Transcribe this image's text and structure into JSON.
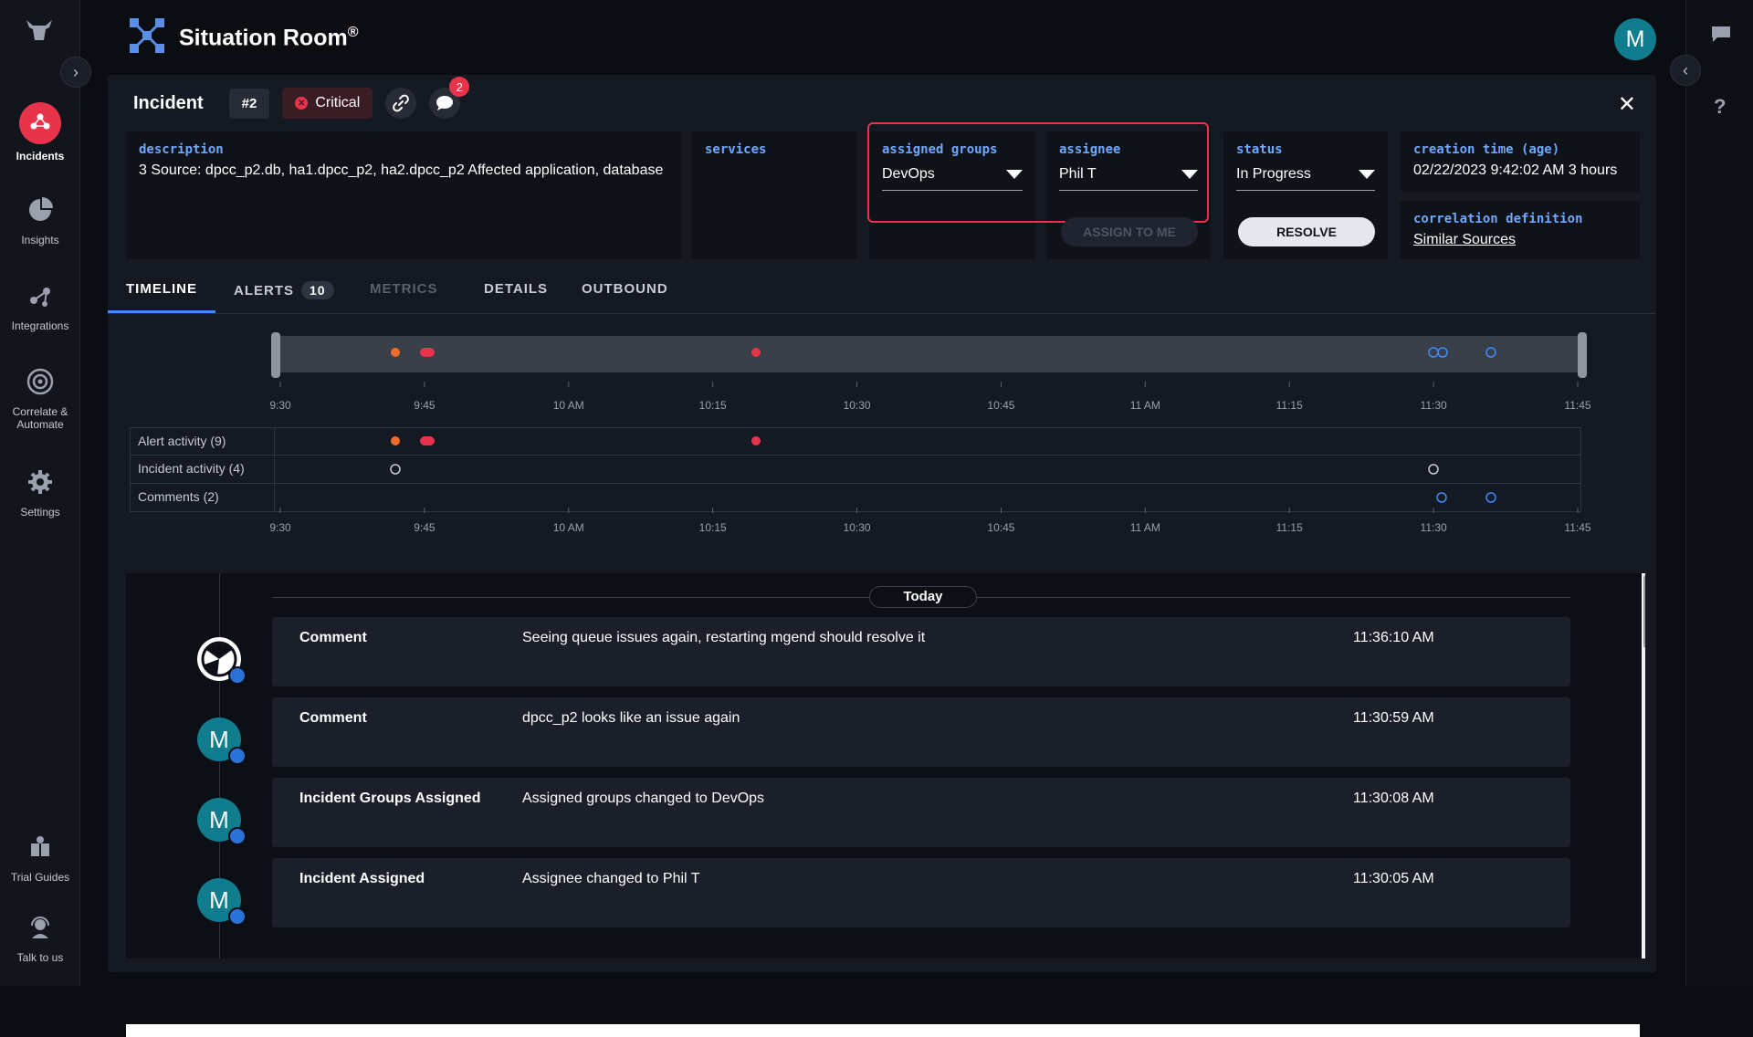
{
  "app": {
    "title": "Situation Room",
    "registered_mark": "®",
    "user_initial": "M"
  },
  "nav": {
    "items": [
      {
        "label": "Incidents",
        "icon": "incidents-icon",
        "active": true
      },
      {
        "label": "Insights",
        "icon": "pie-chart-icon",
        "active": false
      },
      {
        "label": "Integrations",
        "icon": "integrations-icon",
        "active": false
      },
      {
        "label": "Correlate &",
        "label2": "Automate",
        "icon": "target-icon",
        "active": false
      },
      {
        "label": "Settings",
        "icon": "gear-icon",
        "active": false
      }
    ],
    "bottom": [
      {
        "label": "Trial Guides",
        "icon": "book-icon"
      },
      {
        "label": "Talk to us",
        "icon": "support-icon"
      }
    ]
  },
  "incident": {
    "title": "Incident",
    "id": "#2",
    "severity": "Critical",
    "comment_count": "2",
    "description_label": "description",
    "description": "3 Source: dpcc_p2.db, ha1.dpcc_p2, ha2.dpcc_p2 Affected application, database",
    "services_label": "services",
    "groups_label": "assigned groups",
    "groups_value": "DevOps",
    "assignee_label": "assignee",
    "assignee_value": "Phil T",
    "assign_button": "ASSIGN TO ME",
    "status_label": "status",
    "status_value": "In Progress",
    "resolve_button": "RESOLVE",
    "creation_label": "creation time (age)",
    "creation_value": "02/22/2023 9:42:02 AM 3 hours",
    "correlation_label": "correlation definition",
    "correlation_value": "Similar Sources"
  },
  "tabs": [
    {
      "label": "TIMELINE",
      "active": true
    },
    {
      "label": "ALERTS",
      "count": "10"
    },
    {
      "label": "METRICS",
      "disabled": true
    },
    {
      "label": "DETAILS"
    },
    {
      "label": "OUTBOUND"
    }
  ],
  "timeline": {
    "ticks": [
      "9:30",
      "9:45",
      "10 AM",
      "10:15",
      "10:30",
      "10:45",
      "11 AM",
      "11:15",
      "11:30",
      "11:45"
    ],
    "tracks": [
      {
        "label": "Alert activity (9)"
      },
      {
        "label": "Incident activity (4)"
      },
      {
        "label": "Comments (2)"
      }
    ],
    "colors": {
      "alert_orange": "#f26b2b",
      "alert_red": "#e8344b",
      "comment_blue": "#3e8bff",
      "incident_gray": "#c7cbd4"
    }
  },
  "feed": {
    "day_label": "Today",
    "entries": [
      {
        "type": "Comment",
        "message": "Seeing queue issues again, restarting mgend should resolve it",
        "time": "11:36:10 AM",
        "avatar": "logo"
      },
      {
        "type": "Comment",
        "message": "dpcc_p2 looks like an issue again",
        "time": "11:30:59 AM",
        "avatar": "M"
      },
      {
        "type": "Incident Groups Assigned",
        "message": "Assigned groups changed to DevOps",
        "time": "11:30:08 AM",
        "avatar": "M"
      },
      {
        "type": "Incident Assigned",
        "message": "Assignee changed to Phil T",
        "time": "11:30:05 AM",
        "avatar": "M"
      }
    ]
  }
}
